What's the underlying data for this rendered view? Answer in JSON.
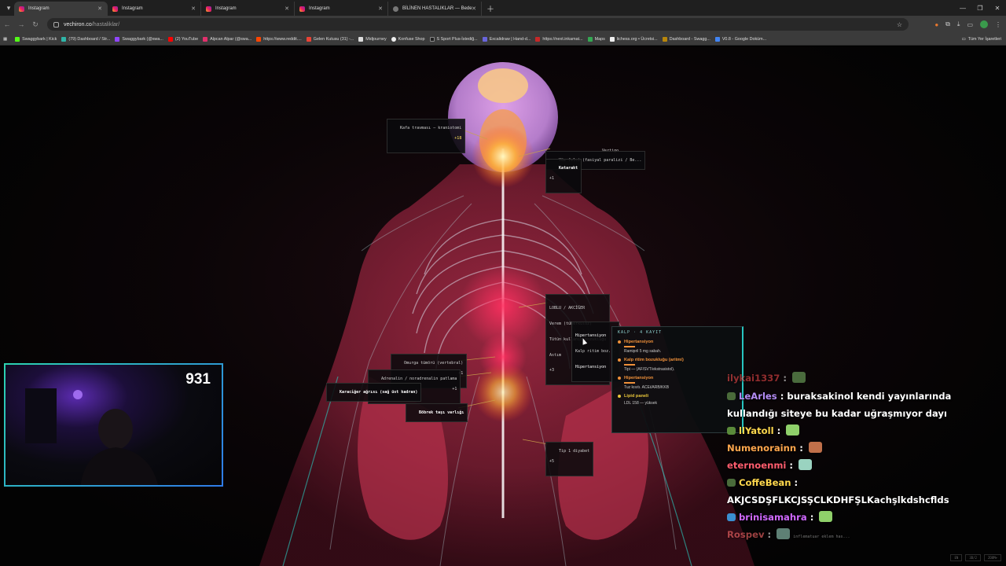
{
  "browser": {
    "tabs": [
      {
        "title": "Instagram",
        "icon": "instagram-icon"
      },
      {
        "title": "Instagram",
        "icon": "instagram-icon"
      },
      {
        "title": "Instagram",
        "icon": "instagram-icon"
      },
      {
        "title": "Instagram",
        "icon": "instagram-icon"
      },
      {
        "title": "BİLİNEN HASTALIKLAR — Bede",
        "icon": "globe-icon"
      }
    ],
    "url_domain": "vechiron.co",
    "url_path": "/hastaliklar/",
    "bookmarks": [
      "Swaggybark | Kick",
      "(79) Dashboard / Str...",
      "Swaggybark (@swa...",
      "(2) YouTube",
      "Alpcan Alpar (@swa...",
      "https://www.reddit....",
      "Gelen Kutusu (31) -...",
      "Midjourney",
      "Konfuse Shop",
      "S Sport Plus-İstediğ...",
      "Excalidraw | Hand-d...",
      "https://next.inkamat...",
      "Maps",
      "lichess.org • Ücretsi...",
      "Dashboard - Swagg...",
      "V0.8 - Google Doküm..."
    ],
    "bookmarks_folder": "Tüm Yer İşaretleri"
  },
  "anatomy": {
    "labels": {
      "head": {
        "text": "Kafa travması — kraniotomi",
        "count": "+18"
      },
      "vertigo": {
        "text": "Vertigo"
      },
      "face": {
        "text": "Yüz felci (fasiyal paralizi / Be..."
      },
      "cataract": {
        "text": "Katarakt",
        "count": "+1"
      },
      "lung_title": {
        "text": "LOBLU / AKCİĞER"
      },
      "lung_1": {
        "text": "Verem (tüberküloz)"
      },
      "lung_2": {
        "text": "Tütün kullanım bozukluğu"
      },
      "lung_3": {
        "text": "Astım"
      },
      "lung_count": {
        "text": "+3"
      },
      "heart_1": {
        "text": "Hipertansiyon"
      },
      "heart_2": {
        "text": "Kalp ritim boz..."
      },
      "heart_3": {
        "text": "Hipertansiyon"
      },
      "spine": {
        "text": "Omurga tümörü (vertebral)",
        "count": "+1"
      },
      "adrenal": {
        "text": "Adrenalin / noradrenalin patlama",
        "count": "+1"
      },
      "liver": {
        "text": "Karaciğer ağrısı (sağ üst kadran)"
      },
      "kidney": {
        "text": "Böbrek taşı varlığı"
      },
      "diabetes": {
        "text": "Tip 1 diyabet",
        "count": "+5"
      }
    },
    "popup": {
      "title": "KALP · 4 KAYIT",
      "entries": [
        {
          "name": "Hipertansiyon",
          "desc": "Ramipril 5 mg sabah.",
          "color": "#f0913a"
        },
        {
          "name": "Kalp ritim bozukluğu (aritmi)",
          "desc": "Tipi — (AF/SVT/ekstrasistol).",
          "color": "#f0913a"
        },
        {
          "name": "Hipertansiyon",
          "desc": "Tuz kısıtı. ACEi/ARB/KKB",
          "color": "#f0913a"
        },
        {
          "name": "Lipid paneli",
          "desc": "LDL 158 — yüksek",
          "color": "#e8c53a"
        }
      ]
    },
    "controls": [
      "EN",
      "3D/2",
      "ZOOM+"
    ]
  },
  "stream": {
    "viewer_count": "931",
    "chat": [
      {
        "user": "ilykai1337",
        "text": "",
        "color": "#ff4d4d"
      },
      {
        "user": "LeArles",
        "text": "buraksakinol kendi yayınlarında kullandığı siteye bu kadar uğraşmıyor dayı",
        "color": "#b48cf5"
      },
      {
        "user": "llYatoll",
        "text": "",
        "color": "#ffd84d"
      },
      {
        "user": "Numenorainn",
        "text": "",
        "color": "#ffa64d"
      },
      {
        "user": "eternoenmi",
        "text": "",
        "color": "#ff5d6e"
      },
      {
        "user": "CoffeBean",
        "text": "AKJCSDŞFLKCJSŞCLKDHFŞLKachşlkdshcflds",
        "color": "#ffd84d"
      },
      {
        "user": "brinisamahra",
        "text": "",
        "color": "#d069ff"
      },
      {
        "user": "Rospev",
        "text": "inflematuar eklem has...",
        "color": "#ff6a6a"
      }
    ]
  }
}
